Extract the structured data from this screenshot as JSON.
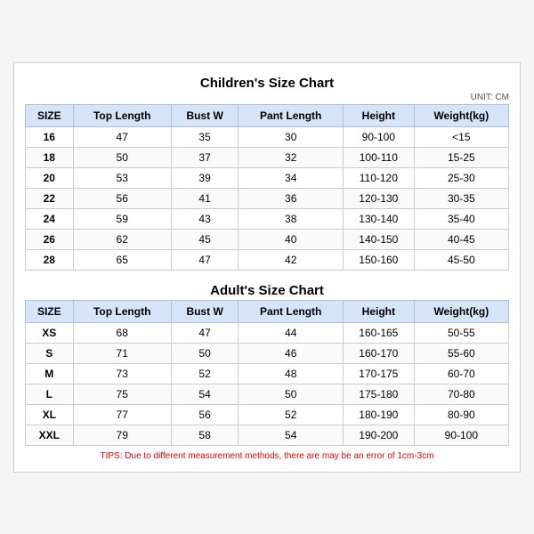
{
  "children_title": "Children's Size Chart",
  "adult_title": "Adult's Size Chart",
  "unit": "UNIT: CM",
  "columns": [
    "SIZE",
    "Top Length",
    "Bust W",
    "Pant Length",
    "Height",
    "Weight(kg)"
  ],
  "children_rows": [
    [
      "16",
      "47",
      "35",
      "30",
      "90-100",
      "<15"
    ],
    [
      "18",
      "50",
      "37",
      "32",
      "100-110",
      "15-25"
    ],
    [
      "20",
      "53",
      "39",
      "34",
      "110-120",
      "25-30"
    ],
    [
      "22",
      "56",
      "41",
      "36",
      "120-130",
      "30-35"
    ],
    [
      "24",
      "59",
      "43",
      "38",
      "130-140",
      "35-40"
    ],
    [
      "26",
      "62",
      "45",
      "40",
      "140-150",
      "40-45"
    ],
    [
      "28",
      "65",
      "47",
      "42",
      "150-160",
      "45-50"
    ]
  ],
  "adult_rows": [
    [
      "XS",
      "68",
      "47",
      "44",
      "160-165",
      "50-55"
    ],
    [
      "S",
      "71",
      "50",
      "46",
      "160-170",
      "55-60"
    ],
    [
      "M",
      "73",
      "52",
      "48",
      "170-175",
      "60-70"
    ],
    [
      "L",
      "75",
      "54",
      "50",
      "175-180",
      "70-80"
    ],
    [
      "XL",
      "77",
      "56",
      "52",
      "180-190",
      "80-90"
    ],
    [
      "XXL",
      "79",
      "58",
      "54",
      "190-200",
      "90-100"
    ]
  ],
  "tips": "TIPS: Due to different measurement methods, there are may be an error of 1cm-3cm"
}
